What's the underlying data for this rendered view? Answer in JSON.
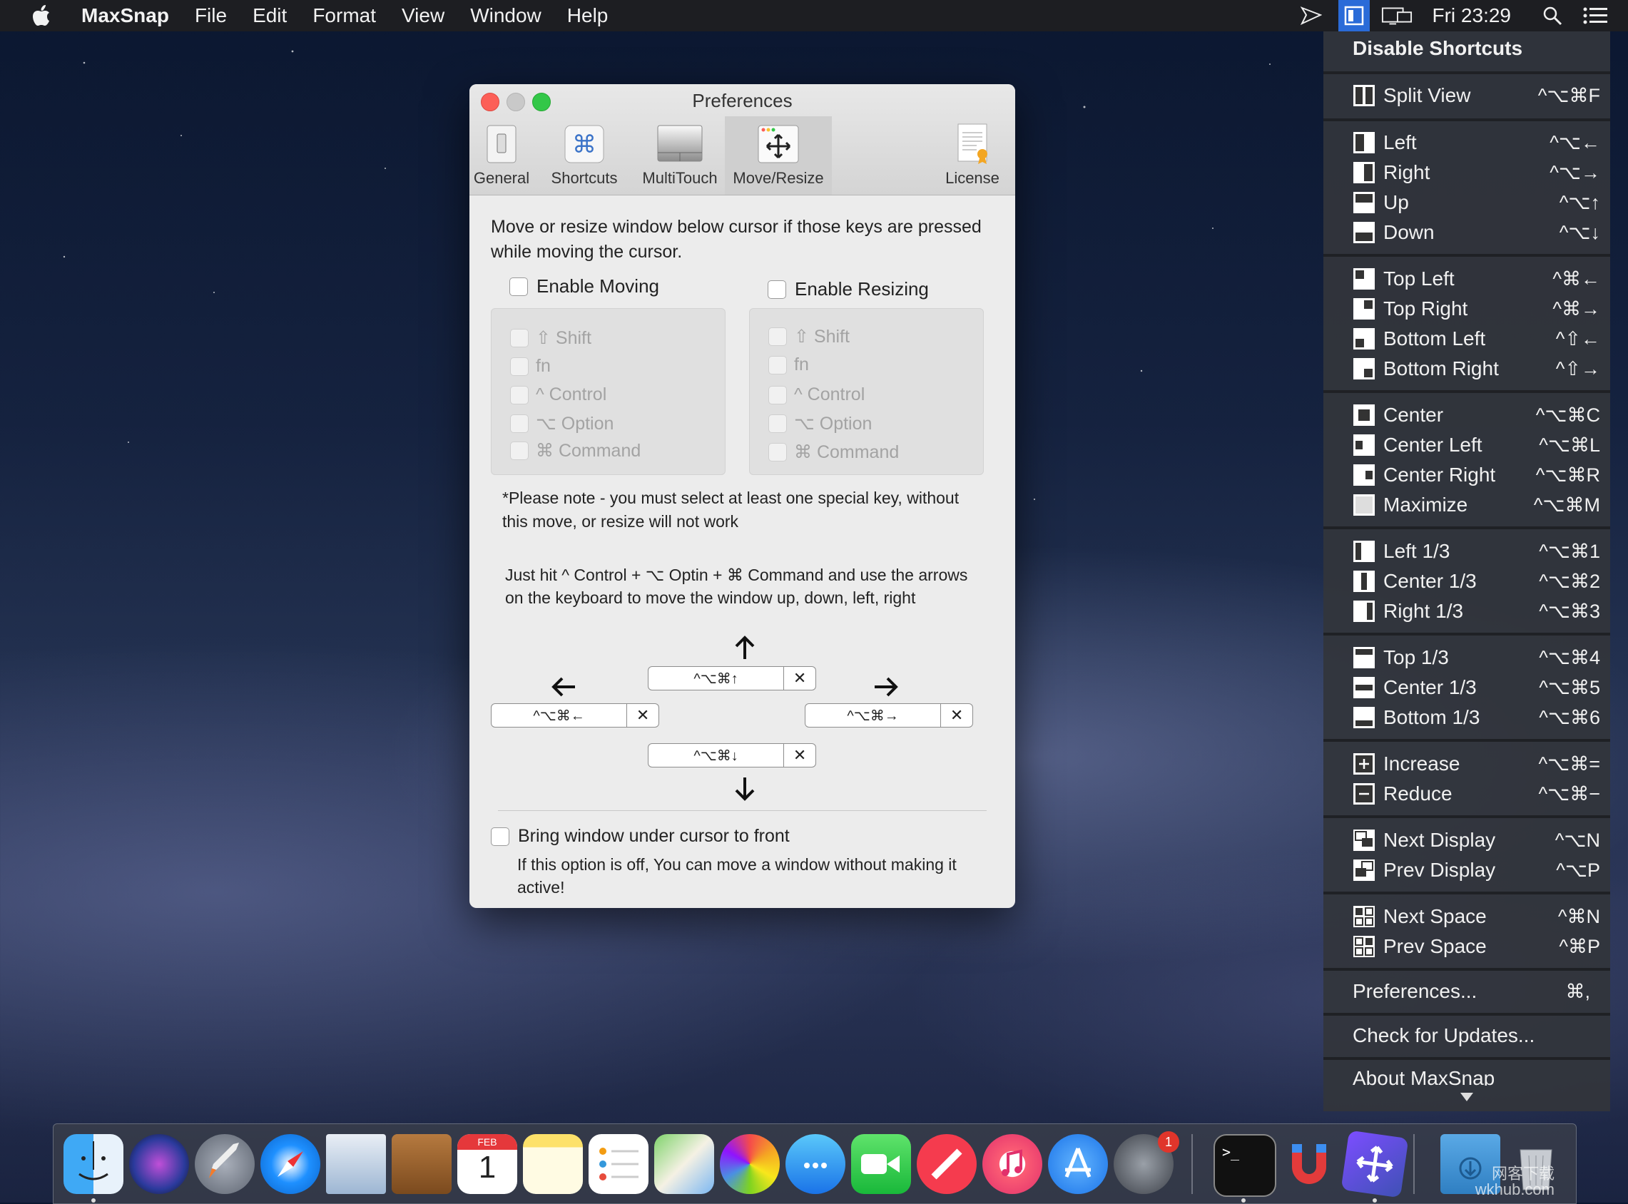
{
  "menubar": {
    "app_name": "MaxSnap",
    "menus": [
      "File",
      "Edit",
      "Format",
      "View",
      "Window",
      "Help"
    ],
    "clock": "Fri 23:29"
  },
  "prefs": {
    "title": "Preferences",
    "tabs": [
      "General",
      "Shortcuts",
      "MultiTouch",
      "Move/Resize",
      "License"
    ],
    "selected_tab": "Move/Resize",
    "intro": "Move or resize window below cursor if those keys are pressed while moving the cursor.",
    "enable_moving": "Enable Moving",
    "enable_resizing": "Enable Resizing",
    "modifiers": [
      "⇧ Shift",
      "fn",
      "^ Control",
      "⌥ Option",
      "⌘ Command"
    ],
    "note": "*Please note - you must select at least one special key, without this move, or resize will not work",
    "hint": "Just hit  ^ Control  + ⌥ Optin + ⌘ Command and use the arrows on the keyboard to move the window up, down, left, right",
    "keys": {
      "up": "^⌥⌘↑",
      "left": "^⌥⌘←",
      "right": "^⌥⌘→",
      "down": "^⌥⌘↓",
      "clear": "✕"
    },
    "bring_to_front": "Bring window under cursor to front",
    "bring_to_front_note": "If this option is off, You can move a window without making it active!"
  },
  "dropdown": {
    "header": "Disable Shortcuts",
    "items": [
      {
        "label": "Split View",
        "shortcut": "^⌥⌘F"
      },
      {
        "label": "Left",
        "shortcut": "^⌥←"
      },
      {
        "label": "Right",
        "shortcut": "^⌥→"
      },
      {
        "label": "Up",
        "shortcut": "^⌥↑"
      },
      {
        "label": "Down",
        "shortcut": "^⌥↓"
      },
      {
        "label": "Top Left",
        "shortcut": "^⌘←"
      },
      {
        "label": "Top Right",
        "shortcut": "^⌘→"
      },
      {
        "label": "Bottom Left",
        "shortcut": "^⇧←"
      },
      {
        "label": "Bottom Right",
        "shortcut": "^⇧→"
      },
      {
        "label": "Center",
        "shortcut": "^⌥⌘C"
      },
      {
        "label": "Center Left",
        "shortcut": "^⌥⌘L"
      },
      {
        "label": "Center Right",
        "shortcut": "^⌥⌘R"
      },
      {
        "label": "Maximize",
        "shortcut": "^⌥⌘M"
      },
      {
        "label": "Left 1/3",
        "shortcut": "^⌥⌘1"
      },
      {
        "label": "Center 1/3",
        "shortcut": "^⌥⌘2"
      },
      {
        "label": "Right 1/3",
        "shortcut": "^⌥⌘3"
      },
      {
        "label": "Top 1/3",
        "shortcut": "^⌥⌘4"
      },
      {
        "label": "Center 1/3",
        "shortcut": "^⌥⌘5"
      },
      {
        "label": "Bottom 1/3",
        "shortcut": "^⌥⌘6"
      },
      {
        "label": "Increase",
        "shortcut": "^⌥⌘="
      },
      {
        "label": "Reduce",
        "shortcut": "^⌥⌘−"
      },
      {
        "label": "Next Display",
        "shortcut": "^⌥N"
      },
      {
        "label": "Prev Display",
        "shortcut": "^⌥P"
      },
      {
        "label": "Next Space",
        "shortcut": "^⌘N"
      },
      {
        "label": "Prev Space",
        "shortcut": "^⌘P"
      }
    ],
    "preferences": "Preferences...",
    "preferences_shortcut": "⌘,",
    "check_updates": "Check for Updates...",
    "about": "About MaxSnap"
  },
  "dock": {
    "calendar_month": "FEB",
    "calendar_day": "1",
    "settings_badge": "1",
    "watermark_line1": "网客下载",
    "watermark_line2": "wkhub.com"
  }
}
